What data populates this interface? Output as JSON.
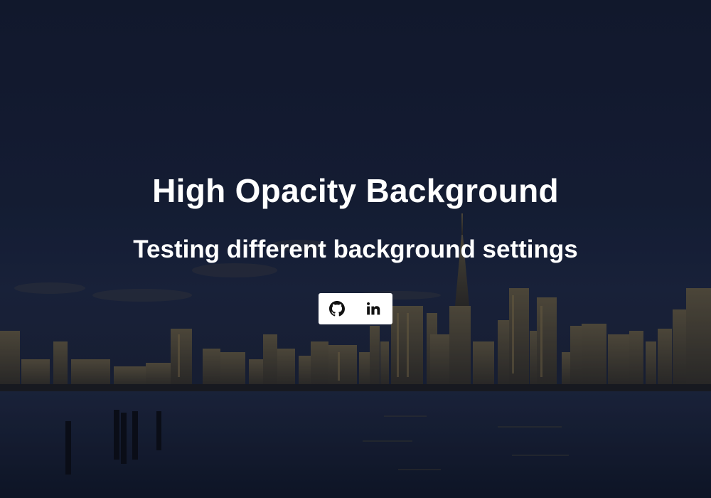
{
  "hero": {
    "title": "High Opacity Background",
    "subtitle": "Testing different background settings"
  },
  "social": {
    "links": [
      {
        "icon": "github-icon"
      },
      {
        "icon": "linkedin-icon"
      }
    ]
  },
  "colors": {
    "overlay": "#131a30",
    "text": "#ffffff",
    "social_bg": "#ffffff",
    "icon": "#111111"
  }
}
